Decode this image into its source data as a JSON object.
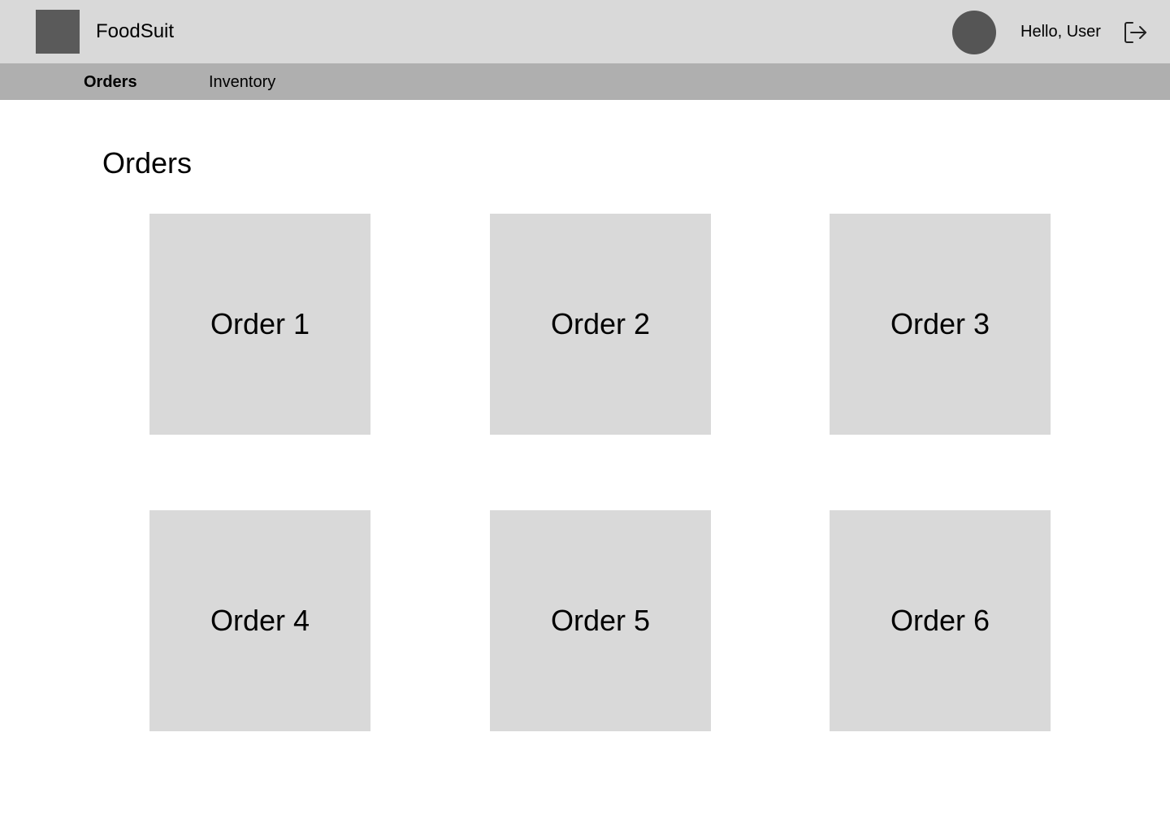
{
  "header": {
    "app_name": "FoodSuit",
    "greeting": "Hello, User",
    "logo_icon": "app-logo",
    "avatar_icon": "user-avatar",
    "logout_icon": "logout-icon"
  },
  "nav": {
    "tabs": [
      {
        "label": "Orders",
        "active": true
      },
      {
        "label": "Inventory",
        "active": false
      }
    ]
  },
  "main": {
    "title": "Orders",
    "orders": [
      {
        "label": "Order 1"
      },
      {
        "label": "Order 2"
      },
      {
        "label": "Order 3"
      },
      {
        "label": "Order 4"
      },
      {
        "label": "Order 5"
      },
      {
        "label": "Order 6"
      }
    ]
  },
  "colors": {
    "header_bg": "#d9d9d9",
    "nav_bg": "#afafaf",
    "card_bg": "#d9d9d9",
    "logo": "#5a5a5a",
    "avatar": "#555555"
  }
}
